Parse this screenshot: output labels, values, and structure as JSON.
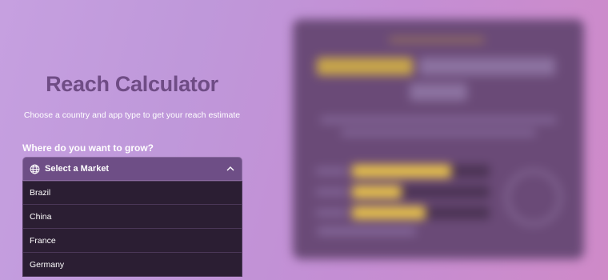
{
  "calculator": {
    "title": "Reach Calculator",
    "subtitle": "Choose a country and app type to get your reach estimate",
    "market_label": "Where do you want to grow?",
    "select_placeholder": "Select a Market",
    "globe_icon": "globe-icon",
    "chevron_icon": "chevron-up-icon",
    "options": [
      "Brazil",
      "China",
      "France",
      "Germany"
    ]
  },
  "colors": {
    "title": "#6f4c85",
    "select_bg": "#6e4e86",
    "option_bg": "#2b1e33",
    "accent": "#e8c24a"
  }
}
